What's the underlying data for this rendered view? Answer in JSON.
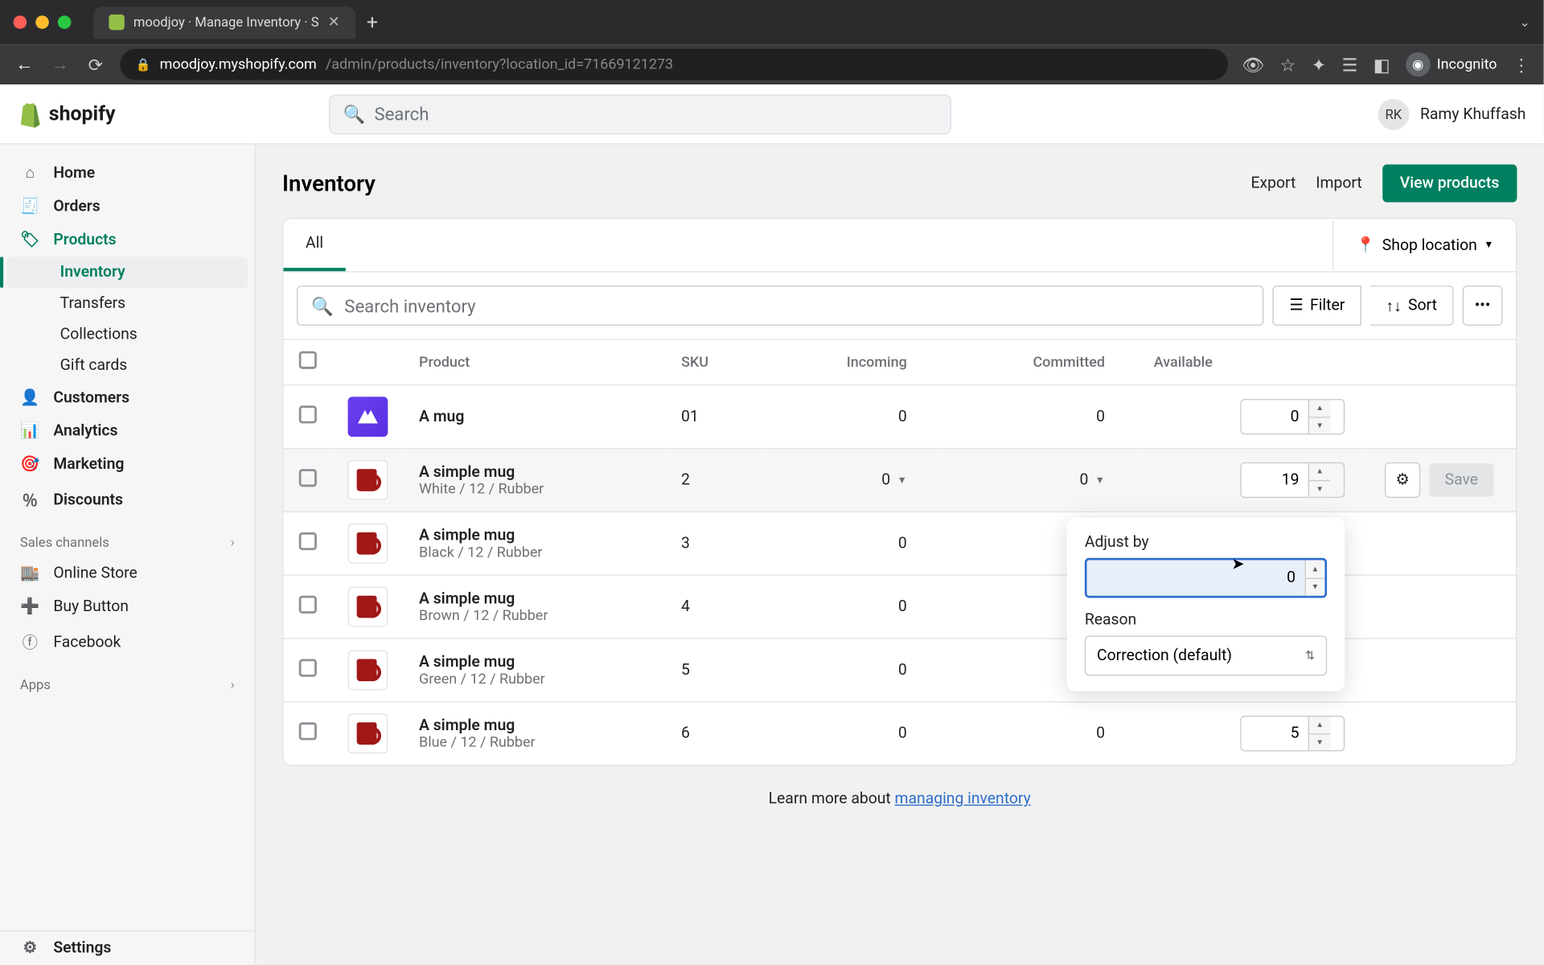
{
  "browser": {
    "tab_title": "moodjoy · Manage Inventory · S",
    "url_host": "moodjoy.myshopify.com",
    "url_path": "/admin/products/inventory?location_id=71669121273",
    "incognito": "Incognito"
  },
  "header": {
    "brand": "shopify",
    "search_placeholder": "Search",
    "user_initials": "RK",
    "user_name": "Ramy Khuffash"
  },
  "sidebar": {
    "home": "Home",
    "orders": "Orders",
    "products": "Products",
    "inventory": "Inventory",
    "transfers": "Transfers",
    "collections": "Collections",
    "giftcards": "Gift cards",
    "customers": "Customers",
    "analytics": "Analytics",
    "marketing": "Marketing",
    "discounts": "Discounts",
    "sales_channels": "Sales channels",
    "online_store": "Online Store",
    "buy_button": "Buy Button",
    "facebook": "Facebook",
    "apps": "Apps",
    "settings": "Settings"
  },
  "page": {
    "title": "Inventory",
    "export": "Export",
    "import": "Import",
    "view_products": "View products",
    "tab_all": "All",
    "shop_location": "Shop location",
    "search_placeholder": "Search inventory",
    "filter": "Filter",
    "sort": "Sort"
  },
  "columns": {
    "product": "Product",
    "sku": "SKU",
    "incoming": "Incoming",
    "committed": "Committed",
    "available": "Available"
  },
  "rows": [
    {
      "name": "A mug",
      "variant": "",
      "sku": "01",
      "incoming": "0",
      "committed": "0",
      "available": "0",
      "hl": false,
      "thumb": "purple"
    },
    {
      "name": "A simple mug",
      "variant": "White / 12 / Rubber",
      "sku": "2",
      "incoming": "0",
      "committed": "0",
      "available": "19",
      "hl": true,
      "thumb": "mug",
      "dd": true
    },
    {
      "name": "A simple mug",
      "variant": "Black / 12 / Rubber",
      "sku": "3",
      "incoming": "0",
      "committed": "",
      "available": "",
      "hl": false,
      "thumb": "mug"
    },
    {
      "name": "A simple mug",
      "variant": "Brown / 12 / Rubber",
      "sku": "4",
      "incoming": "0",
      "committed": "",
      "available": "",
      "hl": false,
      "thumb": "mug"
    },
    {
      "name": "A simple mug",
      "variant": "Green / 12 / Rubber",
      "sku": "5",
      "incoming": "0",
      "committed": "",
      "available": "",
      "hl": false,
      "thumb": "mug"
    },
    {
      "name": "A simple mug",
      "variant": "Blue / 12 / Rubber",
      "sku": "6",
      "incoming": "0",
      "committed": "0",
      "available": "5",
      "hl": false,
      "thumb": "mug"
    }
  ],
  "row_actions": {
    "save": "Save"
  },
  "popover": {
    "adjust_by": "Adjust by",
    "value": "0",
    "reason": "Reason",
    "reason_value": "Correction (default)"
  },
  "footer": {
    "learn": "Learn more about ",
    "link": "managing inventory"
  }
}
